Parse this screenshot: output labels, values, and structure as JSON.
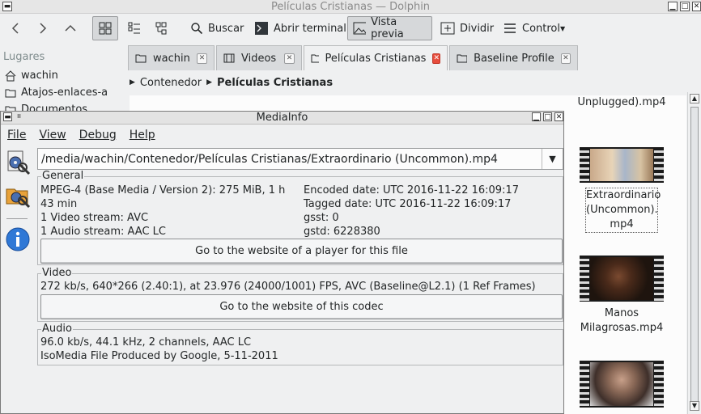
{
  "dolphin": {
    "window_title": "Películas Cristianas — Dolphin",
    "toolbar": {
      "search_label": "Buscar",
      "terminal_label": "Abrir terminal",
      "preview_label": "Vista previa",
      "split_label": "Dividir",
      "control_label": "Control"
    },
    "places": {
      "heading": "Lugares",
      "items": [
        {
          "label": "wachin",
          "icon": "home-icon"
        },
        {
          "label": "Atajos-enlaces-a",
          "icon": "folder-icon"
        },
        {
          "label": "Documentos",
          "icon": "folder-icon"
        }
      ]
    },
    "tabs": [
      {
        "label": "wachin",
        "icon": "folder-icon"
      },
      {
        "label": "Videos",
        "icon": "video-folder-icon"
      },
      {
        "label": "Películas Cristianas",
        "icon": "folder-icon",
        "active": true
      },
      {
        "label": "Baseline Profile",
        "icon": "folder-icon"
      }
    ],
    "breadcrumb": [
      "Contenedor",
      "Películas Cristianas"
    ],
    "files": [
      {
        "name_tail": "Unplugged).mp4"
      },
      {
        "name": "Extraordinario (Uncommon).mp4",
        "lines": [
          "Extraordinario",
          "(Uncommon).",
          "mp4"
        ]
      },
      {
        "name": "Manos Milagrosas.mp4",
        "lines": [
          "Manos",
          "Milagrosas.mp4"
        ]
      }
    ]
  },
  "mediainfo": {
    "window_title": "MediaInfo",
    "menu": [
      "File",
      "View",
      "Debug",
      "Help"
    ],
    "file_path": "/media/wachin/Contenedor/Películas Cristianas/Extraordinario (Uncommon).mp4",
    "general": {
      "title": "General",
      "left_lines": [
        "MPEG-4 (Base Media / Version 2): 275 MiB, 1 h",
        "43 min",
        "1 Video stream: AVC",
        "1 Audio stream: AAC LC"
      ],
      "right_lines": [
        "Encoded date: UTC 2016-11-22 16:09:17",
        "Tagged date: UTC 2016-11-22 16:09:17",
        "gsst: 0",
        "gstd: 6228380"
      ],
      "button": "Go to the website of a player for this file"
    },
    "video": {
      "title": "Video",
      "line": "272 kb/s, 640*266 (2.40:1), at 23.976 (24000/1001) FPS, AVC (Baseline@L2.1) (1 Ref Frames)",
      "button": "Go to the website of this codec"
    },
    "audio": {
      "title": "Audio",
      "lines": [
        "96.0 kb/s, 44.1 kHz, 2 channels, AAC LC",
        "IsoMedia File Produced by Google, 5-11-2011"
      ]
    }
  }
}
